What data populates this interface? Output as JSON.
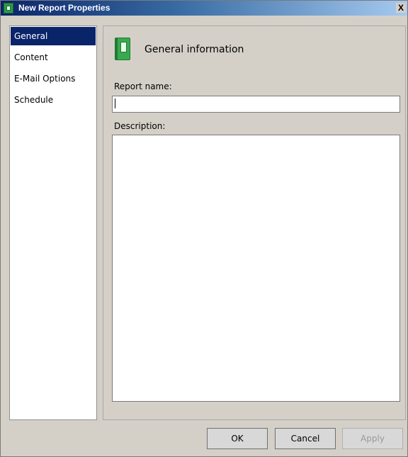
{
  "window": {
    "title": "New Report Properties",
    "close_label": "X"
  },
  "nav": {
    "items": [
      {
        "label": "General",
        "selected": true
      },
      {
        "label": "Content",
        "selected": false
      },
      {
        "label": "E-Mail Options",
        "selected": false
      },
      {
        "label": "Schedule",
        "selected": false
      }
    ]
  },
  "panel": {
    "icon": "green-book-icon",
    "title": "General information",
    "report_name_label": "Report name:",
    "report_name_value": "",
    "description_label": "Description:",
    "description_value": ""
  },
  "buttons": {
    "ok": "OK",
    "cancel": "Cancel",
    "apply": "Apply",
    "apply_enabled": false
  },
  "colors": {
    "title_bar": "#0a246a",
    "selected_nav": "#0a246a",
    "window_bg": "#d4d0c8",
    "icon_green": "#3aa84f"
  }
}
